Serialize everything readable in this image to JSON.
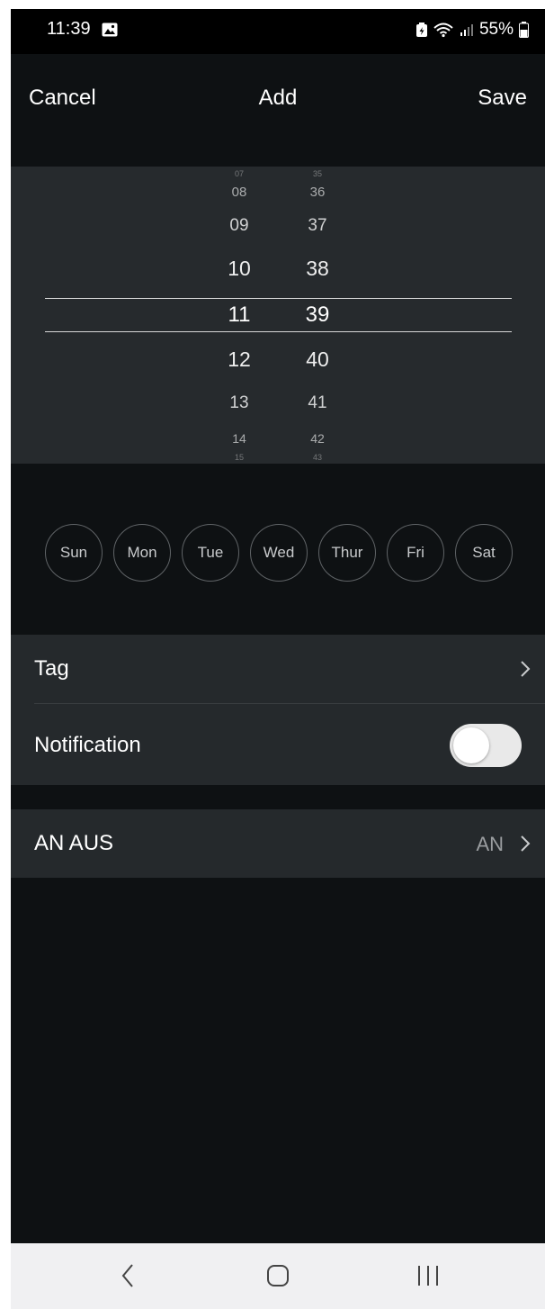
{
  "status_bar": {
    "time": "11:39",
    "battery": "55%",
    "icons": [
      "gallery-icon",
      "battery-saver-icon",
      "wifi-icon",
      "signal-icon",
      "battery-icon"
    ]
  },
  "header": {
    "cancel_label": "Cancel",
    "title": "Add",
    "save_label": "Save"
  },
  "time_picker": {
    "hours": [
      "07",
      "08",
      "09",
      "10",
      "11",
      "12",
      "13",
      "14",
      "15"
    ],
    "minutes": [
      "35",
      "36",
      "37",
      "38",
      "39",
      "40",
      "41",
      "42",
      "43"
    ],
    "selected_hour": "11",
    "selected_minute": "39"
  },
  "weekdays": [
    "Sun",
    "Mon",
    "Tue",
    "Wed",
    "Thur",
    "Fri",
    "Sat"
  ],
  "settings": {
    "tag_label": "Tag",
    "notification_label": "Notification",
    "notification_enabled": false,
    "mode_label": "AN AUS",
    "mode_value": "AN"
  },
  "colors": {
    "screen_bg": "#0e1113",
    "panel_bg": "#25292c",
    "picker_bg": "#262a2d",
    "toggle_off": "#e9e9e9"
  }
}
